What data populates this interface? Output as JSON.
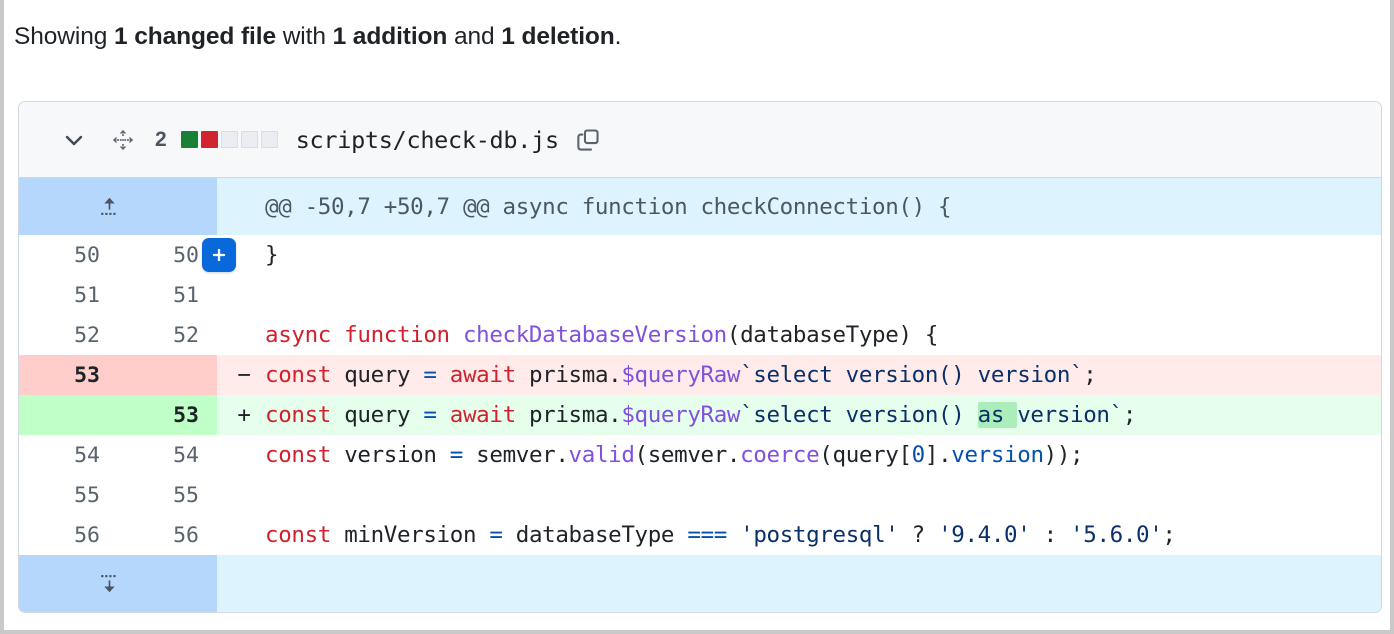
{
  "summary": {
    "prefix": "Showing ",
    "changed_files": "1 changed file",
    "mid": " with ",
    "additions": "1 addition",
    "conj": " and ",
    "deletions": "1 deletion",
    "suffix": "."
  },
  "file_header": {
    "collapse_icon": "chevron-down-icon",
    "move_icon": "move-drag-icon",
    "change_count": "2",
    "diffstat": [
      "add",
      "del",
      "neutral",
      "neutral",
      "neutral"
    ],
    "filename": "scripts/check-db.js",
    "copy_icon": "copy-path-icon"
  },
  "diff": {
    "hunk_header": {
      "expand_icon": "expand-up-icon",
      "text": "@@ -50,7 +50,7 @@ async function checkConnection() {"
    },
    "expand_down": {
      "expand_icon": "expand-down-icon"
    },
    "add_comment_button": "+",
    "rows": [
      {
        "type": "ctx",
        "old_num": "50",
        "new_num": "50",
        "marker": "",
        "has_plus": true,
        "tokens": [
          {
            "t": "}",
            "c": "t-plain"
          }
        ]
      },
      {
        "type": "ctx",
        "old_num": "51",
        "new_num": "51",
        "marker": "",
        "has_plus": false,
        "tokens": []
      },
      {
        "type": "ctx",
        "old_num": "52",
        "new_num": "52",
        "marker": "",
        "has_plus": false,
        "tokens": [
          {
            "t": "async function ",
            "c": "t-kw"
          },
          {
            "t": "checkDatabaseVersion",
            "c": "t-fn"
          },
          {
            "t": "(databaseType) {",
            "c": "t-plain"
          }
        ]
      },
      {
        "type": "del",
        "old_num": "53",
        "new_num": "",
        "marker": "−",
        "has_plus": false,
        "tokens": [
          {
            "t": "  const ",
            "c": "t-kw"
          },
          {
            "t": "query ",
            "c": "t-plain"
          },
          {
            "t": "= ",
            "c": "t-op"
          },
          {
            "t": "await ",
            "c": "t-kw"
          },
          {
            "t": "prisma.",
            "c": "t-plain"
          },
          {
            "t": "$queryRaw",
            "c": "t-fn"
          },
          {
            "t": "`select version() version`",
            "c": "t-str"
          },
          {
            "t": ";",
            "c": "t-plain"
          }
        ]
      },
      {
        "type": "add",
        "old_num": "",
        "new_num": "53",
        "marker": "+",
        "has_plus": false,
        "tokens": [
          {
            "t": "  const ",
            "c": "t-kw"
          },
          {
            "t": "query ",
            "c": "t-plain"
          },
          {
            "t": "= ",
            "c": "t-op"
          },
          {
            "t": "await ",
            "c": "t-kw"
          },
          {
            "t": "prisma.",
            "c": "t-plain"
          },
          {
            "t": "$queryRaw",
            "c": "t-fn"
          },
          {
            "t": "`select version() ",
            "c": "t-str"
          },
          {
            "t": "as ",
            "c": "t-str",
            "hl": true
          },
          {
            "t": "version`",
            "c": "t-str"
          },
          {
            "t": ";",
            "c": "t-plain"
          }
        ]
      },
      {
        "type": "ctx",
        "old_num": "54",
        "new_num": "54",
        "marker": "",
        "has_plus": false,
        "tokens": [
          {
            "t": "  const ",
            "c": "t-kw"
          },
          {
            "t": "version ",
            "c": "t-plain"
          },
          {
            "t": "= ",
            "c": "t-op"
          },
          {
            "t": "semver.",
            "c": "t-plain"
          },
          {
            "t": "valid",
            "c": "t-fn"
          },
          {
            "t": "(semver.",
            "c": "t-plain"
          },
          {
            "t": "coerce",
            "c": "t-fn"
          },
          {
            "t": "(query[",
            "c": "t-plain"
          },
          {
            "t": "0",
            "c": "t-num"
          },
          {
            "t": "].",
            "c": "t-plain"
          },
          {
            "t": "version",
            "c": "t-prop"
          },
          {
            "t": "));",
            "c": "t-plain"
          }
        ]
      },
      {
        "type": "ctx",
        "old_num": "55",
        "new_num": "55",
        "marker": "",
        "has_plus": false,
        "tokens": []
      },
      {
        "type": "ctx",
        "old_num": "56",
        "new_num": "56",
        "marker": "",
        "has_plus": false,
        "tokens": [
          {
            "t": "  const ",
            "c": "t-kw"
          },
          {
            "t": "minVersion ",
            "c": "t-plain"
          },
          {
            "t": "= ",
            "c": "t-op"
          },
          {
            "t": "databaseType ",
            "c": "t-plain"
          },
          {
            "t": "=== ",
            "c": "t-op"
          },
          {
            "t": "'postgresql'",
            "c": "t-str"
          },
          {
            "t": " ? ",
            "c": "t-plain"
          },
          {
            "t": "'9.4.0'",
            "c": "t-str"
          },
          {
            "t": " : ",
            "c": "t-plain"
          },
          {
            "t": "'5.6.0'",
            "c": "t-str"
          },
          {
            "t": ";",
            "c": "t-plain"
          }
        ]
      }
    ]
  },
  "colors": {
    "addition_bg": "#e6ffec",
    "addition_gutter": "#c0ffc7",
    "addition_word": "#aceebb",
    "deletion_bg": "#ffebe9",
    "deletion_gutter": "#ffcecb",
    "hunk_bg": "#ddf4ff",
    "hunk_gutter": "#b6d7fc",
    "accent_blue": "#0969da",
    "stat_add": "#1a7f37",
    "stat_del": "#d1242f"
  }
}
